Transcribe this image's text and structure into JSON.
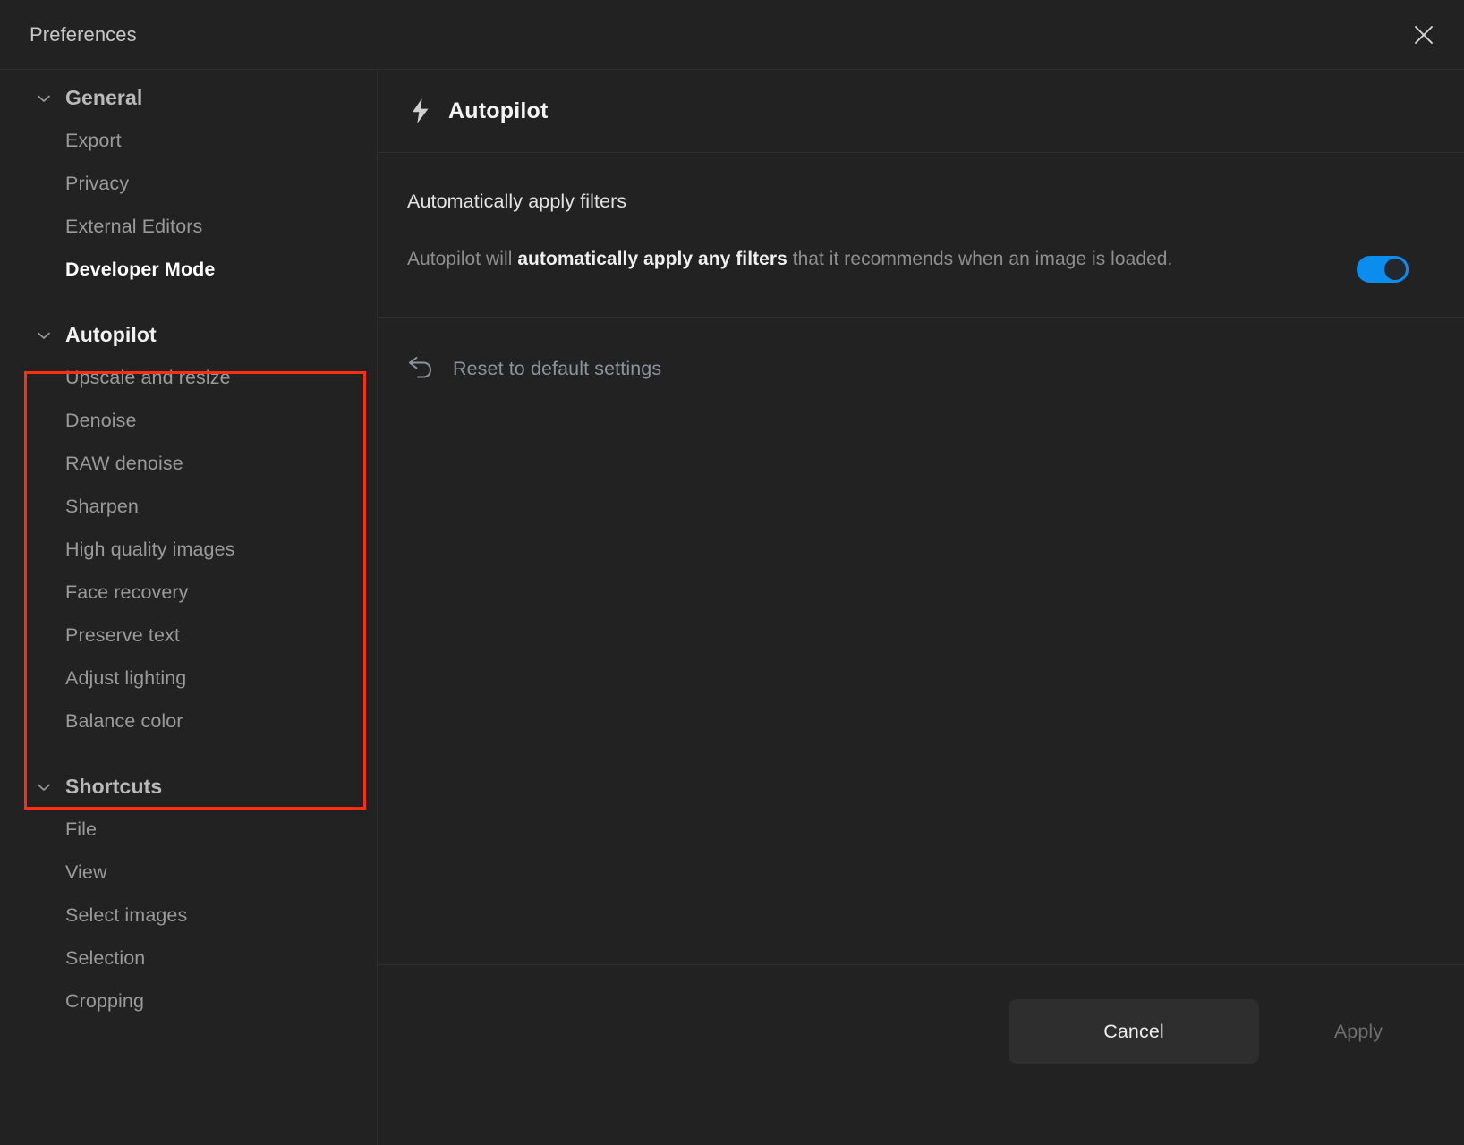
{
  "window": {
    "title": "Preferences",
    "close_icon": "close-icon"
  },
  "sidebar": {
    "groups": [
      {
        "id": "general",
        "label": "General",
        "expanded": true,
        "chevron_icon": "chevron-down-icon",
        "items": [
          {
            "label": "Export",
            "active": false
          },
          {
            "label": "Privacy",
            "active": false
          },
          {
            "label": "External Editors",
            "active": false
          },
          {
            "label": "Developer Mode",
            "active": true
          }
        ]
      },
      {
        "id": "autopilot",
        "label": "Autopilot",
        "expanded": true,
        "highlighted": true,
        "chevron_icon": "chevron-down-icon",
        "items": [
          {
            "label": "Upscale and resize",
            "active": false
          },
          {
            "label": "Denoise",
            "active": false
          },
          {
            "label": "RAW denoise",
            "active": false
          },
          {
            "label": "Sharpen",
            "active": false
          },
          {
            "label": "High quality images",
            "active": false
          },
          {
            "label": "Face recovery",
            "active": false
          },
          {
            "label": "Preserve text",
            "active": false
          },
          {
            "label": "Adjust lighting",
            "active": false
          },
          {
            "label": "Balance color",
            "active": false
          }
        ]
      },
      {
        "id": "shortcuts",
        "label": "Shortcuts",
        "expanded": true,
        "chevron_icon": "chevron-down-icon",
        "items": [
          {
            "label": "File",
            "active": false
          },
          {
            "label": "View",
            "active": false
          },
          {
            "label": "Select images",
            "active": false
          },
          {
            "label": "Selection",
            "active": false
          },
          {
            "label": "Cropping",
            "active": false
          }
        ]
      }
    ]
  },
  "main": {
    "header": {
      "icon": "lightning-bolt-icon",
      "title": "Autopilot"
    },
    "settings": [
      {
        "label": "Automatically apply filters",
        "description_prefix": "Autopilot will ",
        "description_bold": "automatically apply any filters",
        "description_suffix": " that it recommends when an image is loaded.",
        "toggle_on": true
      }
    ],
    "reset": {
      "icon": "undo-arrow-icon",
      "label": "Reset to default settings"
    }
  },
  "footer": {
    "cancel_label": "Cancel",
    "apply_label": "Apply",
    "apply_enabled": false
  },
  "colors": {
    "accent": "#0b8df0",
    "highlight_box": "#fc2f10",
    "background": "#222222",
    "divider": "#2e2e2e",
    "text_primary": "#f2f2f2",
    "text_secondary": "#8e8e8e"
  }
}
